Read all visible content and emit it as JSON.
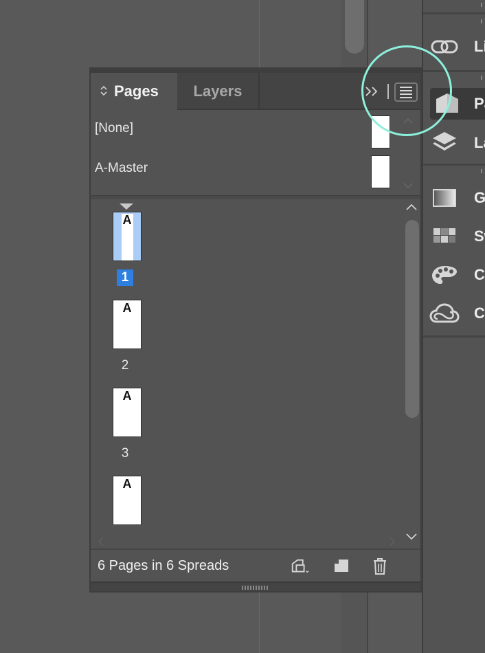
{
  "panel": {
    "tabs": [
      {
        "label": "Pages",
        "updown": "⌃⌄"
      },
      {
        "label": "Layers"
      }
    ],
    "collapse_glyph": "»",
    "masters": [
      {
        "label": "[None]"
      },
      {
        "label": "A-Master"
      }
    ],
    "pages": [
      {
        "number": "1",
        "master": "A",
        "selected": true
      },
      {
        "number": "2",
        "master": "A",
        "selected": false
      },
      {
        "number": "3",
        "master": "A",
        "selected": false
      },
      {
        "number": "",
        "master": "A",
        "selected": false
      }
    ],
    "footer": {
      "summary": "6 Pages in 6 Spreads"
    }
  },
  "dock": {
    "items": [
      {
        "label": "Li",
        "icon": "links-icon"
      },
      {
        "label": "Pa",
        "icon": "pages-icon",
        "active": true
      },
      {
        "label": "La",
        "icon": "layers-icon"
      },
      {
        "label": "G",
        "icon": "gradient-icon"
      },
      {
        "label": "Sw",
        "icon": "swatches-icon"
      },
      {
        "label": "C",
        "icon": "color-theme-icon"
      },
      {
        "label": "C",
        "icon": "cc-libraries-icon"
      }
    ]
  },
  "colors": {
    "workspace": "#595959",
    "panel": "#535353",
    "selected_page": "#a9cdf7",
    "selected_number": "#2d7fe0",
    "highlight_ring": "#8df0dc"
  }
}
